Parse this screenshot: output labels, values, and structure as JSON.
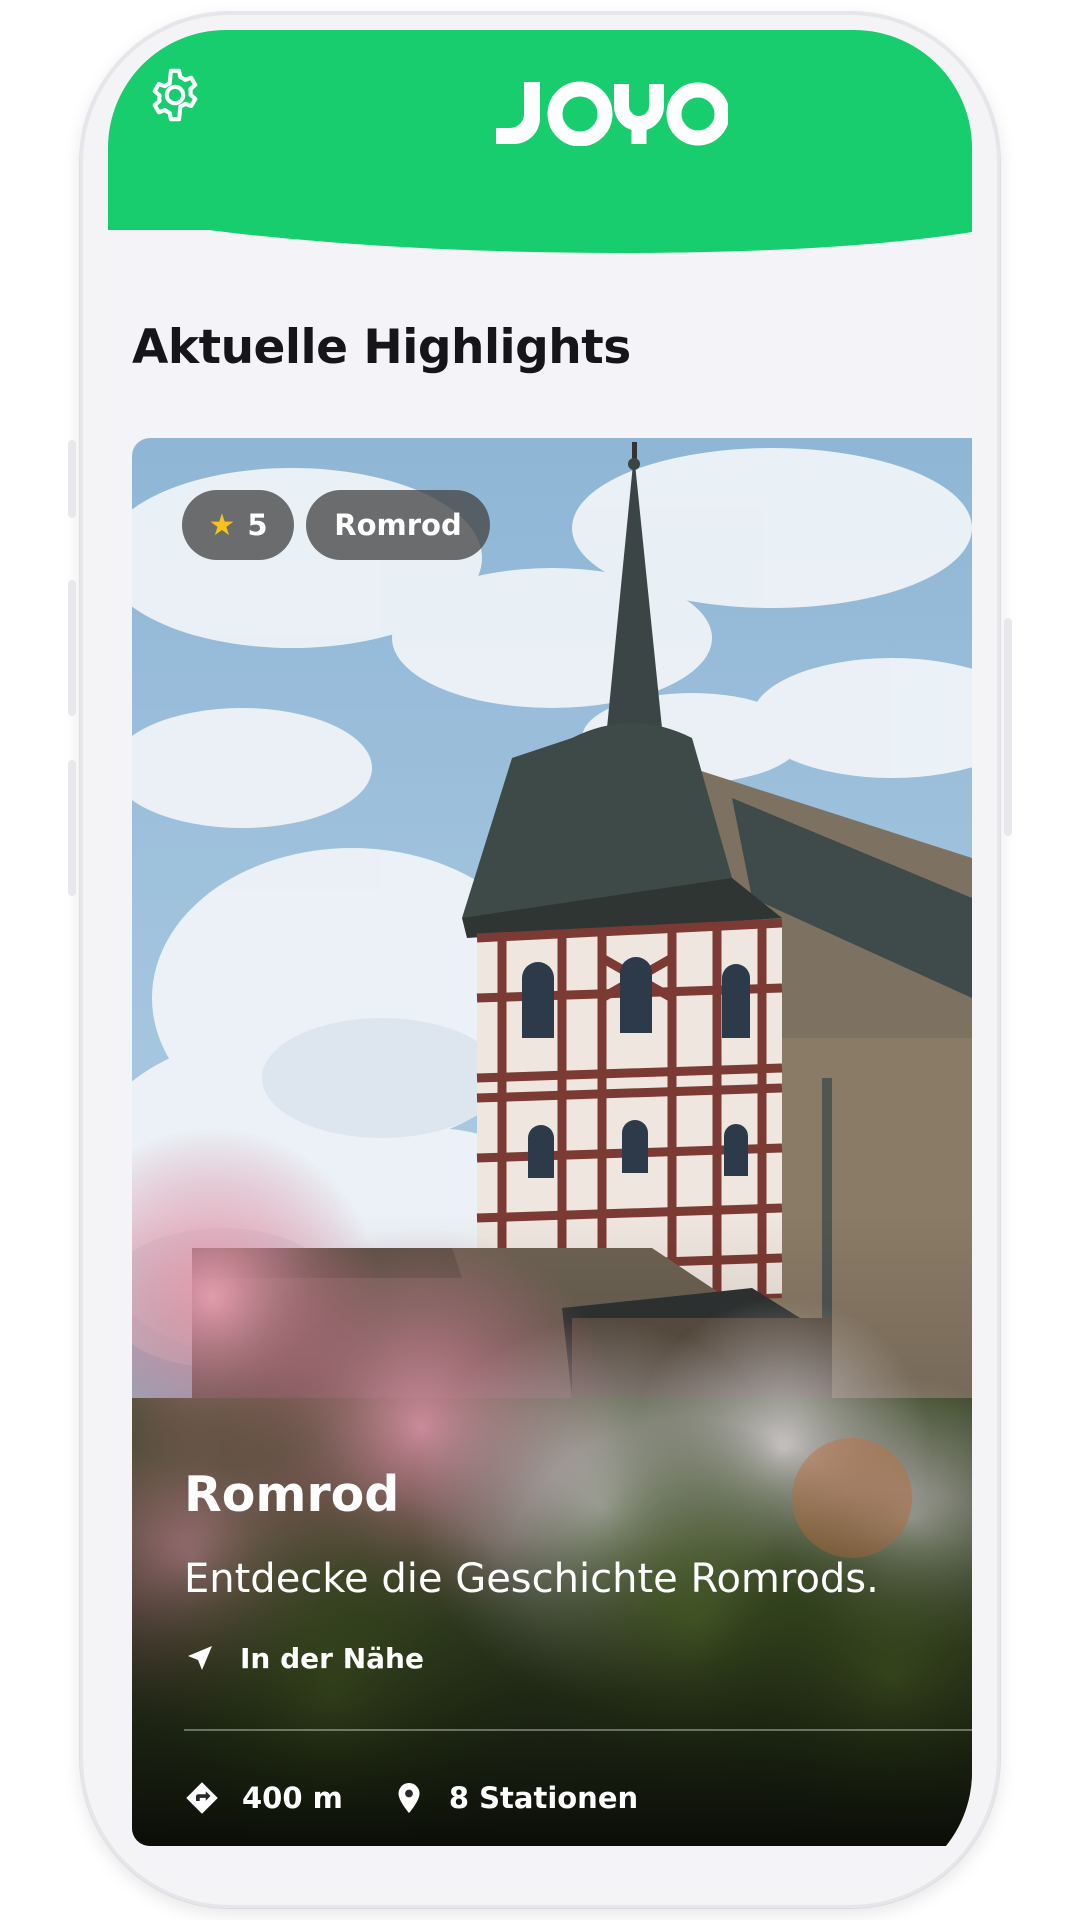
{
  "app": {
    "logo_text": "JOYO",
    "brand_color": "#17cd6e",
    "settings_icon": "gear-icon"
  },
  "main": {
    "section_title": "Aktuelle Highlights"
  },
  "highlight_card": {
    "rating": "5",
    "rating_icon": "star-icon",
    "location_badge": "Romrod",
    "title": "Romrod",
    "subtitle": "Entdecke die Geschichte Romrods.",
    "nearby_label": "In der Nähe",
    "nearby_icon": "navigation-arrow-icon",
    "distance": "400 m",
    "distance_icon": "directions-icon",
    "stations": "8 Stationen",
    "stations_icon": "map-pin-icon",
    "image": "castle-tower-photo"
  }
}
